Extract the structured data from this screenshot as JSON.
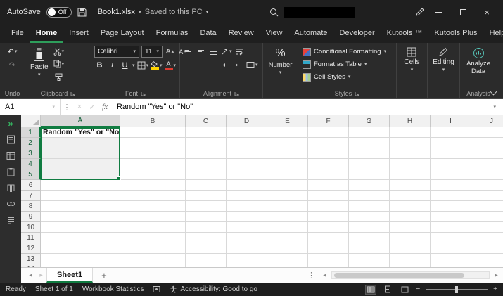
{
  "colors": {
    "accent_green": "#107C41",
    "tab_underline_green": "#2e9e5b",
    "share_green": "#0f7b3f",
    "fill_yellow": "#ffd400",
    "font_red": "#e03c31",
    "titlebar_bg": "#1f1f1f",
    "ribbon_bg": "#2b2b2b"
  },
  "icons": {
    "chevron_down": "▾",
    "chevron_up": "▴",
    "chevron_left": "◂",
    "chevron_right": "▸",
    "double_chevron_right": "»",
    "more_vertical": "⋮",
    "cancel": "×",
    "check": "✓",
    "undo": "↶",
    "redo": "↷",
    "minus": "−",
    "plus": "+",
    "close": "×",
    "bullet": "•"
  },
  "titlebar": {
    "autosave_label": "AutoSave",
    "autosave_state": "Off",
    "workbook_name": "Book1.xlsx",
    "saved_status": "Saved to this PC"
  },
  "tabs": [
    "File",
    "Home",
    "Insert",
    "Page Layout",
    "Formulas",
    "Data",
    "Review",
    "View",
    "Automate",
    "Developer",
    "Kutools ™",
    "Kutools Plus",
    "Help"
  ],
  "active_tab": "Home",
  "ribbon": {
    "paste_label": "Paste",
    "font_name": "Calibri",
    "font_size": "11",
    "bold_label": "B",
    "italic_label": "I",
    "underline_label": "U",
    "grow_font_label": "A",
    "shrink_font_label": "A",
    "percent_symbol": "%",
    "number_label": "Number",
    "styles_items": [
      "Conditional Formatting",
      "Format as Table",
      "Cell Styles"
    ],
    "cells_label": "Cells",
    "editing_label": "Editing",
    "analyze_label": "Analyze Data",
    "group_labels": {
      "undo": "Undo",
      "clipboard": "Clipboard",
      "font": "Font",
      "alignment": "Alignment",
      "styles": "Styles",
      "analysis": "Analysis"
    }
  },
  "formula_bar": {
    "name_box": "A1",
    "fx_label": "fx",
    "value": "Random \"Yes\" or \"No\""
  },
  "grid": {
    "columns": [
      "A",
      "B",
      "C",
      "D",
      "E",
      "F",
      "G",
      "H",
      "I",
      "J"
    ],
    "row_count": 14,
    "cells": {
      "A1": "Random \"Yes\" or \"No\""
    },
    "bold_cells": [
      "A1"
    ],
    "selection": {
      "col": "A",
      "row_start": 1,
      "row_end": 5,
      "active_cell": "A1",
      "range": "A1:A5"
    }
  },
  "sheetbar": {
    "sheet1_label": "Sheet1",
    "add_label": "+"
  },
  "statusbar": {
    "ready": "Ready",
    "sheet_count": "Sheet 1 of 1",
    "workbook_statistics": "Workbook Statistics",
    "accessibility": "Accessibility: Good to go"
  }
}
